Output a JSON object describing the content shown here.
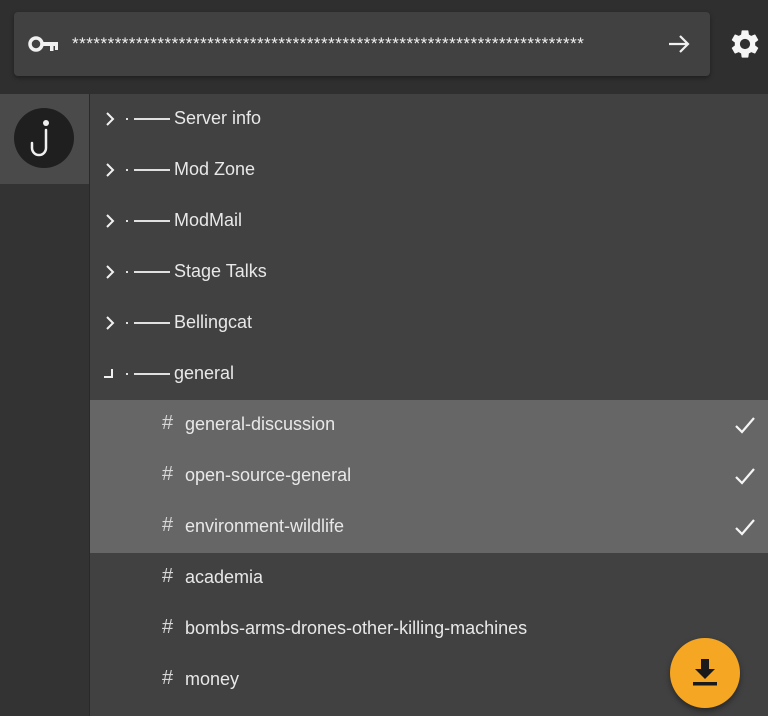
{
  "token": {
    "value": "************************************************************************",
    "icon": "key-icon"
  },
  "toolbar": {
    "submit_icon": "arrow-right-icon",
    "settings_icon": "gear-icon"
  },
  "sidebar": {
    "guilds": [
      {
        "icon": "hook-question-icon"
      }
    ]
  },
  "categories": [
    {
      "label": "Server info",
      "state": "collapsed"
    },
    {
      "label": "Mod Zone",
      "state": "collapsed"
    },
    {
      "label": "ModMail",
      "state": "collapsed"
    },
    {
      "label": "Stage Talks",
      "state": "collapsed"
    },
    {
      "label": "Bellingcat",
      "state": "collapsed"
    },
    {
      "label": "general",
      "state": "expanded"
    }
  ],
  "channels": [
    {
      "hash": "#",
      "label": "general-discussion",
      "selected": true
    },
    {
      "hash": "#",
      "label": "open-source-general",
      "selected": true
    },
    {
      "hash": "#",
      "label": "environment-wildlife",
      "selected": true
    },
    {
      "hash": "#",
      "label": "academia",
      "selected": false
    },
    {
      "hash": "#",
      "label": "bombs-arms-drones-other-killing-machines",
      "selected": false
    },
    {
      "hash": "#",
      "label": "money",
      "selected": false
    }
  ],
  "fab": {
    "icon": "download-icon"
  },
  "colors": {
    "accent": "#f5a623",
    "selected_row": "#666666",
    "panel": "#414141"
  }
}
